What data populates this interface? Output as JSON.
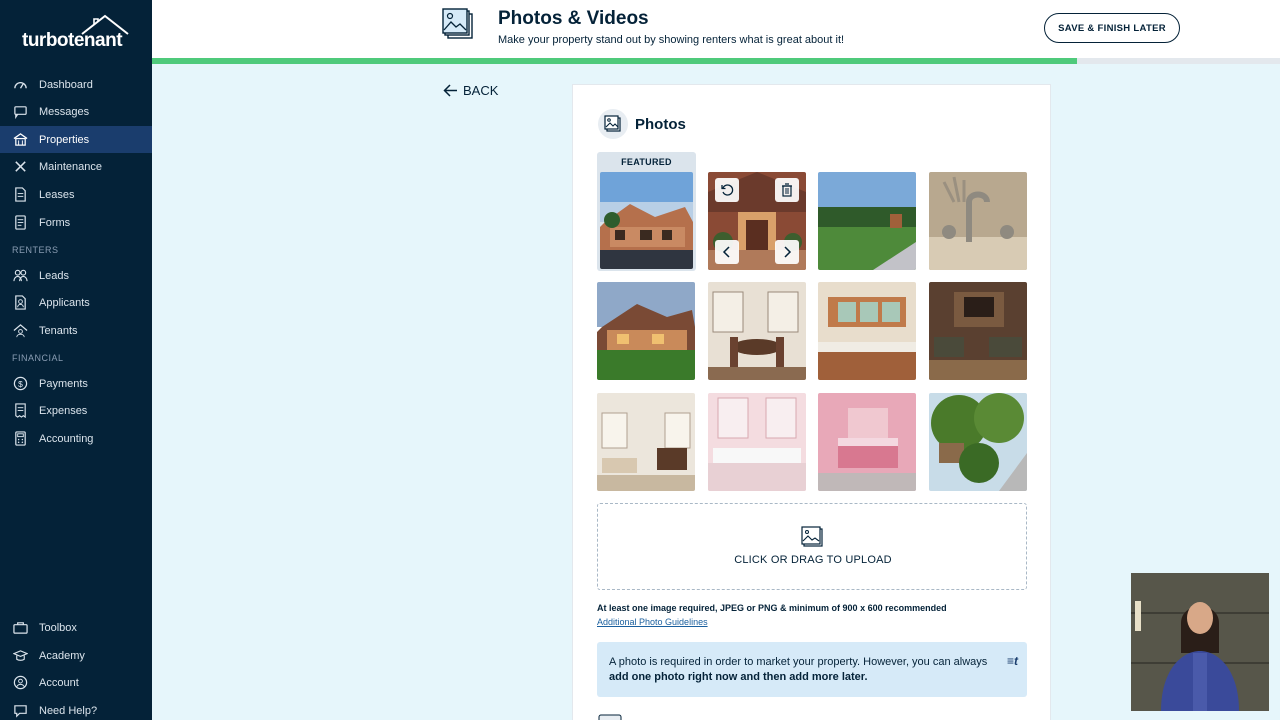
{
  "sidebar": {
    "brand": "turbotenant",
    "items_main": [
      {
        "label": "Dashboard",
        "icon": "dashboard-icon"
      },
      {
        "label": "Messages",
        "icon": "messages-icon"
      },
      {
        "label": "Properties",
        "icon": "properties-icon",
        "active": true
      },
      {
        "label": "Maintenance",
        "icon": "maintenance-icon"
      },
      {
        "label": "Leases",
        "icon": "leases-icon"
      },
      {
        "label": "Forms",
        "icon": "forms-icon"
      }
    ],
    "section_renters": "RENTERS",
    "items_renters": [
      {
        "label": "Leads",
        "icon": "leads-icon"
      },
      {
        "label": "Applicants",
        "icon": "applicants-icon"
      },
      {
        "label": "Tenants",
        "icon": "tenants-icon"
      }
    ],
    "section_financial": "FINANCIAL",
    "items_financial": [
      {
        "label": "Payments",
        "icon": "payments-icon"
      },
      {
        "label": "Expenses",
        "icon": "expenses-icon"
      },
      {
        "label": "Accounting",
        "icon": "accounting-icon"
      }
    ],
    "items_bottom": [
      {
        "label": "Toolbox",
        "icon": "toolbox-icon"
      },
      {
        "label": "Academy",
        "icon": "academy-icon"
      },
      {
        "label": "Account",
        "icon": "account-icon"
      },
      {
        "label": "Need Help?",
        "icon": "help-icon"
      }
    ]
  },
  "header": {
    "title": "Photos & Videos",
    "subtitle": "Make your property stand out by showing renters what is great about it!",
    "save_label": "SAVE & FINISH LATER",
    "progress": 0.82
  },
  "back_label": "BACK",
  "photos": {
    "title": "Photos",
    "featured_label": "FEATURED",
    "items": [
      {
        "name": "photo-exterior-front",
        "featured": true
      },
      {
        "name": "photo-entrance",
        "hovered": true
      },
      {
        "name": "photo-yard-path"
      },
      {
        "name": "photo-faucet"
      },
      {
        "name": "photo-exterior-dusk"
      },
      {
        "name": "photo-dining-room"
      },
      {
        "name": "photo-kitchen"
      },
      {
        "name": "photo-living-room"
      },
      {
        "name": "photo-bedroom-sitting"
      },
      {
        "name": "photo-bathroom-pink"
      },
      {
        "name": "photo-bedroom-pink"
      },
      {
        "name": "photo-garden"
      }
    ],
    "upload_label": "CLICK OR DRAG TO UPLOAD",
    "requirements": "At least one image required, JPEG or PNG & minimum of 900 x 600 recommended",
    "guidelines_link": "Additional Photo Guidelines",
    "tip_text_plain": "A photo is required in order to market your property. However, you can always ",
    "tip_text_bold": "add one photo right now and then add more later.",
    "tip_logo": "≡t"
  },
  "colors": {
    "sidebar_bg": "#042238",
    "active_bg": "#1a3d6d",
    "progress": "#4fca7b",
    "page_bg": "#e6f6fb",
    "tip_bg": "#d6eaf8"
  }
}
